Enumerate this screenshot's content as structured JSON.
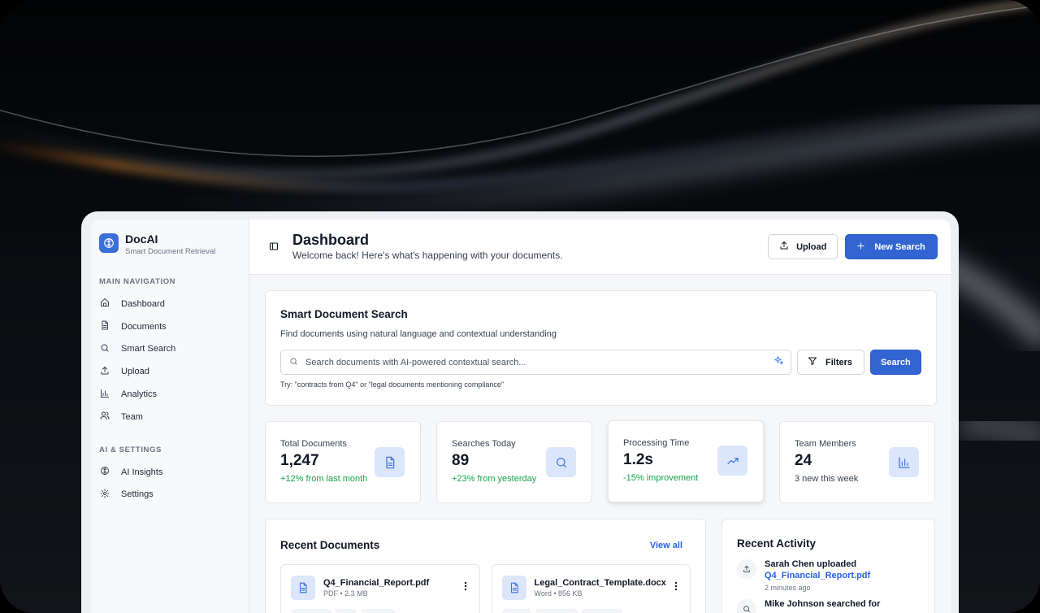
{
  "brand": {
    "name": "DocAI",
    "tagline": "Smart Document Retrieval",
    "logo_icon": "brain-icon",
    "accent_color": "#3265d2"
  },
  "sidebar": {
    "main_nav_title": "MAIN NAVIGATION",
    "main_items": [
      {
        "label": "Dashboard",
        "icon": "home-icon"
      },
      {
        "label": "Documents",
        "icon": "document-icon"
      },
      {
        "label": "Smart Search",
        "icon": "search-icon"
      },
      {
        "label": "Upload",
        "icon": "upload-icon"
      },
      {
        "label": "Analytics",
        "icon": "bar-chart-icon"
      },
      {
        "label": "Team",
        "icon": "users-icon"
      }
    ],
    "ai_settings_title": "AI & SETTINGS",
    "ai_items": [
      {
        "label": "AI Insights",
        "icon": "brain-icon"
      },
      {
        "label": "Settings",
        "icon": "gear-icon"
      }
    ]
  },
  "header": {
    "title": "Dashboard",
    "subtitle": "Welcome back! Here's what's happening with your documents.",
    "upload_label": "Upload",
    "new_search_label": "New Search"
  },
  "search": {
    "title": "Smart Document Search",
    "description": "Find documents using natural language and contextual understanding",
    "placeholder": "Search documents with AI-powered contextual search...",
    "value": "",
    "filters_label": "Filters",
    "search_label": "Search",
    "hint": "Try: \"contracts from Q4\" or \"legal documents mentioning compliance\""
  },
  "stats": [
    {
      "label": "Total Documents",
      "value": "1,247",
      "note": "+12% from last month",
      "note_color": "#16a34a",
      "icon": "document-icon"
    },
    {
      "label": "Searches Today",
      "value": "89",
      "note": "+23% from yesterday",
      "note_color": "#16a34a",
      "icon": "search-icon"
    },
    {
      "label": "Processing Time",
      "value": "1.2s",
      "note": "-15% improvement",
      "note_color": "#16a34a",
      "icon": "trending-up-icon"
    },
    {
      "label": "Team Members",
      "value": "24",
      "note": "3 new this week",
      "note_color": "#374151",
      "icon": "bar-chart-icon"
    }
  ],
  "recent_documents": {
    "title": "Recent Documents",
    "view_all_label": "View all",
    "items": [
      {
        "name": "Q4_Financial_Report.pdf",
        "meta": "PDF • 2.3 MB"
      },
      {
        "name": "Legal_Contract_Template.docx",
        "meta": "Word • 856 KB"
      }
    ]
  },
  "recent_activity": {
    "title": "Recent Activity",
    "items": [
      {
        "actor_text": "Sarah Chen uploaded",
        "link": "Q4_Financial_Report.pdf",
        "time": "2 minutes ago",
        "icon": "upload-icon"
      },
      {
        "actor_text": "Mike Johnson searched for",
        "icon": "search-icon"
      }
    ]
  }
}
